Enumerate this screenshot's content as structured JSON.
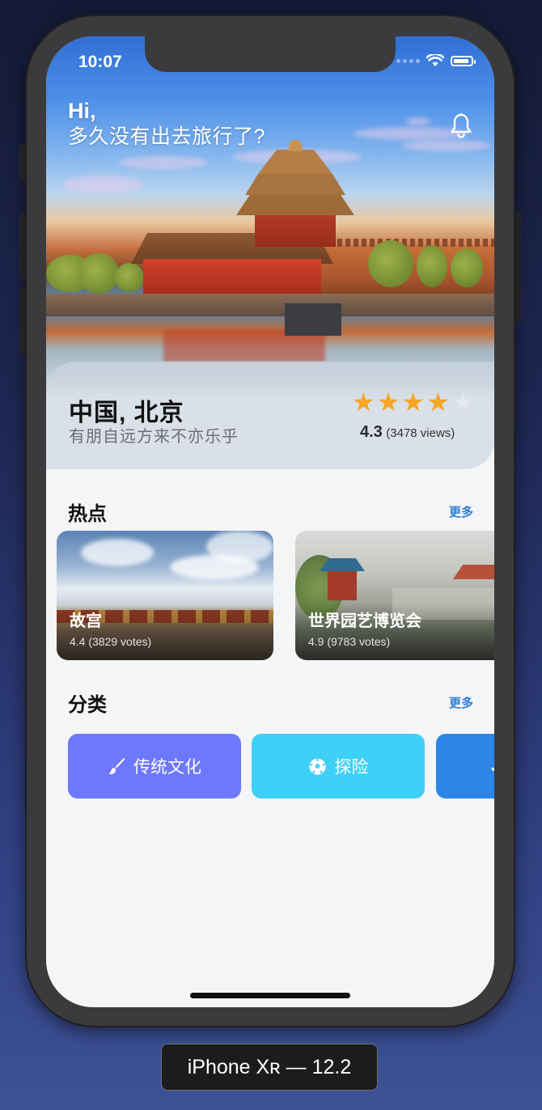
{
  "status_bar": {
    "time": "10:07"
  },
  "hero": {
    "greeting_hi": "Hi,",
    "greeting_sub": "多久没有出去旅行了?",
    "place_name": "中国, 北京",
    "place_tagline": "有朋自远方来不亦乐乎",
    "rating": {
      "value": "4.3",
      "views": "(3478 views)",
      "stars_filled": 4,
      "stars_total": 5,
      "star_color": "#f6a524",
      "star_empty_color": "#e6e8ec"
    }
  },
  "hot": {
    "title": "热点",
    "more": "更多",
    "cards": [
      {
        "name": "故宫",
        "votes": "4.4 (3829 votes)"
      },
      {
        "name": "世界园艺博览会",
        "votes": "4.9 (9783 votes)"
      }
    ]
  },
  "categories": {
    "title": "分类",
    "more": "更多",
    "items": [
      {
        "label": "传统文化",
        "icon": "brush-icon",
        "color": "#6e78fb"
      },
      {
        "label": "探险",
        "icon": "soccer-ball-icon",
        "color": "#3fd0f7"
      },
      {
        "label": "",
        "icon": "partial-icon",
        "color": "#2d86e6"
      }
    ]
  },
  "device_label": "iPhone Xʀ — 12.2"
}
